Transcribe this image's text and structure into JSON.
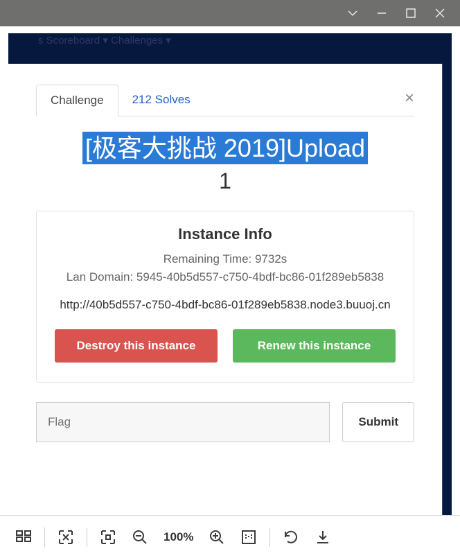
{
  "bg_menu": "s    Scoreboard ▾    Challenges ▾",
  "tabs": {
    "challenge": "Challenge",
    "solves": "212 Solves"
  },
  "title": {
    "selected": "[极客大挑战 2019]Upload",
    "num": "1"
  },
  "instance": {
    "heading": "Instance Info",
    "time_label": "Remaining Time: 9732s",
    "lan": "Lan Domain: 5945-40b5d557-c750-4bdf-bc86-01f289eb5838",
    "url": "http://40b5d557-c750-4bdf-bc86-01f289eb5838.node3.buuoj.cn",
    "destroy": "Destroy this instance",
    "renew": "Renew this instance"
  },
  "flag": {
    "placeholder": "Flag",
    "submit": "Submit"
  },
  "toolbar": {
    "zoom": "100%"
  }
}
